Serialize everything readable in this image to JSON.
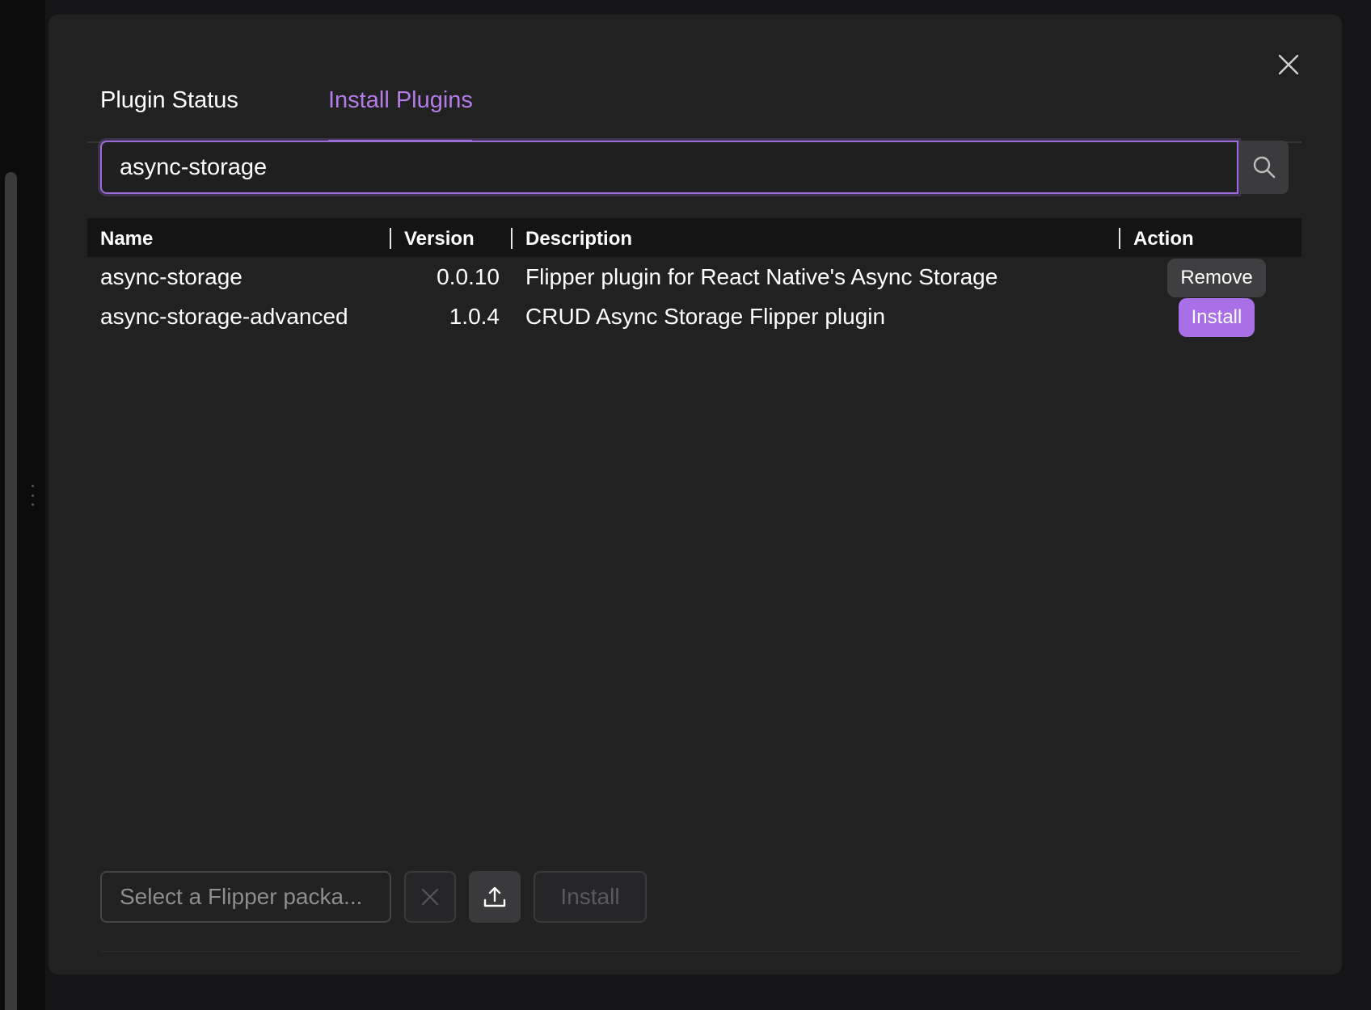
{
  "tabs": {
    "status_label": "Plugin Status",
    "install_label": "Install Plugins",
    "active": "Install Plugins"
  },
  "search": {
    "value": "async-storage"
  },
  "table": {
    "headers": [
      "Name",
      "Version",
      "Description",
      "Action"
    ],
    "rows": [
      {
        "name": "async-storage",
        "version": "0.0.10",
        "description": "Flipper plugin for React Native's Async Storage",
        "action": "Remove"
      },
      {
        "name": "async-storage-advanced",
        "version": "1.0.4",
        "description": "CRUD Async Storage Flipper plugin",
        "action": "Install"
      }
    ]
  },
  "footer": {
    "file_placeholder": "Select a Flipper packa...",
    "install_label": "Install"
  },
  "icons": {
    "close": "close-icon",
    "search": "search-icon",
    "clear": "clear-icon",
    "upload": "upload-icon"
  },
  "colors": {
    "accent": "#a86fe6",
    "background": "#212122"
  }
}
